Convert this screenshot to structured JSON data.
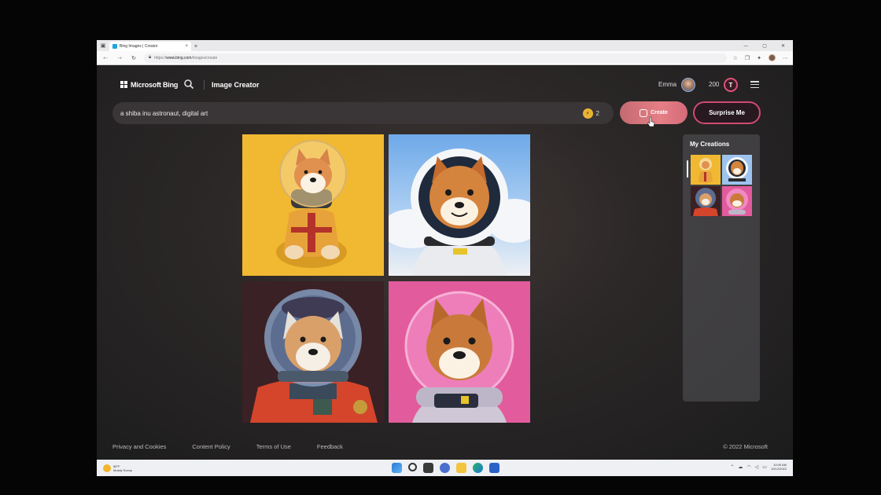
{
  "browser": {
    "tab_title": "Bing Images | Creator",
    "tab_close": "×",
    "new_tab": "+",
    "url_prefix": "https://",
    "url_host": "www.bing.com",
    "url_path": "/images/create"
  },
  "header": {
    "brand": "Microsoft Bing",
    "title": "Image Creator",
    "user_name": "Emma",
    "rewards_points": "200",
    "rewards_badge": "T"
  },
  "prompt": {
    "value": "a shiba inu astronaut, digital art",
    "boost_count": "2",
    "create_label": "Create",
    "surprise_label": "Surprise Me"
  },
  "creations": {
    "title": "My Creations"
  },
  "images": [
    {
      "subject": "shiba inu astronaut, yellow background"
    },
    {
      "subject": "shiba inu astronaut, sky background"
    },
    {
      "subject": "shiba inu astronaut, dark red background"
    },
    {
      "subject": "shiba inu astronaut, pink background"
    }
  ],
  "footer": {
    "links": [
      "Privacy and Cookies",
      "Content Policy",
      "Terms of Use",
      "Feedback"
    ],
    "copyright": "© 2022 Microsoft"
  },
  "taskbar": {
    "weather_temp": "68°F",
    "weather_desc": "Mostly Sunny",
    "time": "10:05 AM",
    "date": "10/12/2022"
  },
  "colors": {
    "accent_create": "#e67f86",
    "accent_surprise": "#d04b73",
    "page_bg": "#2b2727"
  }
}
